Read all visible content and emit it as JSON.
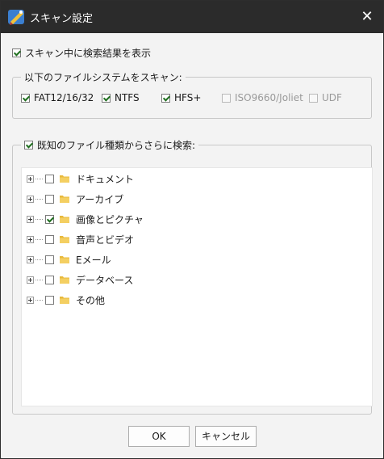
{
  "window": {
    "title": "スキャン設定"
  },
  "options": {
    "show_results_label": "スキャン中に検索結果を表示",
    "show_results_checked": true
  },
  "filesystems": {
    "legend": "以下のファイルシステムをスキャン:",
    "items": [
      {
        "label": "FAT12/16/32",
        "checked": true,
        "enabled": true
      },
      {
        "label": "NTFS",
        "checked": true,
        "enabled": true
      },
      {
        "label": "HFS+",
        "checked": true,
        "enabled": true
      },
      {
        "label": "ISO9660/Joliet",
        "checked": false,
        "enabled": false
      },
      {
        "label": "UDF",
        "checked": false,
        "enabled": false
      }
    ]
  },
  "known_types": {
    "legend": "既知のファイル種類からさらに検索:",
    "checked": true,
    "items": [
      {
        "label": "ドキュメント",
        "checked": false
      },
      {
        "label": "アーカイブ",
        "checked": false
      },
      {
        "label": "画像とピクチャ",
        "checked": true
      },
      {
        "label": "音声とビデオ",
        "checked": false
      },
      {
        "label": "Eメール",
        "checked": false
      },
      {
        "label": "データベース",
        "checked": false
      },
      {
        "label": "その他",
        "checked": false
      }
    ]
  },
  "buttons": {
    "ok": "OK",
    "cancel": "キャンセル"
  },
  "colors": {
    "titlebar": "#2b2b2b",
    "folder": "#e8b93a",
    "check": "#1f6f1f"
  },
  "icons": {
    "app": "app-logo-icon",
    "close": "close-icon",
    "folder": "folder-icon",
    "expand": "plus-expander-icon"
  }
}
